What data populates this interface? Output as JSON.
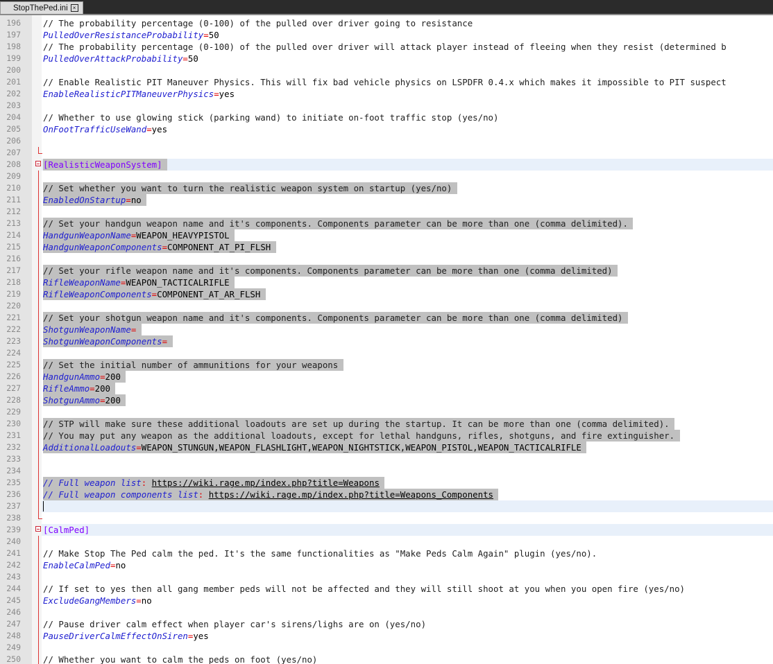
{
  "tab": {
    "title": "StopThePed.ini",
    "close_glyph": "×"
  },
  "editor": {
    "lines": [
      {
        "n": "196",
        "parts": [
          {
            "t": "// The probability percentage (0-100) of the pulled over driver going to resistance",
            "c": "comment"
          }
        ]
      },
      {
        "n": "197",
        "parts": [
          {
            "t": "PulledOverResistanceProbability",
            "c": "key"
          },
          {
            "t": "=",
            "c": "eq"
          },
          {
            "t": "50",
            "c": "val"
          }
        ]
      },
      {
        "n": "198",
        "parts": [
          {
            "t": "// The probability percentage (0-100) of the pulled over driver will attack player instead of fleeing when they resist (determined b",
            "c": "comment"
          }
        ]
      },
      {
        "n": "199",
        "parts": [
          {
            "t": "PulledOverAttackProbability",
            "c": "key"
          },
          {
            "t": "=",
            "c": "eq"
          },
          {
            "t": "50",
            "c": "val"
          }
        ]
      },
      {
        "n": "200",
        "parts": []
      },
      {
        "n": "201",
        "parts": [
          {
            "t": "// Enable Realistic PIT Maneuver Physics. This will fix bad vehicle physics on LSPDFR 0.4.x which makes it impossible to PIT suspect",
            "c": "comment"
          }
        ]
      },
      {
        "n": "202",
        "parts": [
          {
            "t": "EnableRealisticPITManeuverPhysics",
            "c": "key"
          },
          {
            "t": "=",
            "c": "eq"
          },
          {
            "t": "yes",
            "c": "val"
          }
        ]
      },
      {
        "n": "203",
        "parts": []
      },
      {
        "n": "204",
        "parts": [
          {
            "t": "// Whether to use glowing stick (parking wand) to initiate on-foot traffic stop (yes/no)",
            "c": "comment"
          }
        ]
      },
      {
        "n": "205",
        "parts": [
          {
            "t": "OnFootTrafficUseWand",
            "c": "key"
          },
          {
            "t": "=",
            "c": "eq"
          },
          {
            "t": "yes",
            "c": "val"
          }
        ]
      },
      {
        "n": "206",
        "parts": []
      },
      {
        "n": "207",
        "parts": [],
        "fold": "end"
      },
      {
        "n": "208",
        "parts": [
          {
            "t": "[RealisticWeaponSystem]",
            "c": "section"
          }
        ],
        "fold": "start",
        "sel": true,
        "hl": true
      },
      {
        "n": "209",
        "parts": [],
        "fold": "line"
      },
      {
        "n": "210",
        "parts": [
          {
            "t": "// Set whether you want to turn the realistic weapon system on startup (yes/no)",
            "c": "comment"
          }
        ],
        "fold": "line",
        "sel": true
      },
      {
        "n": "211",
        "parts": [
          {
            "t": "EnabledOnStartup",
            "c": "key"
          },
          {
            "t": "=",
            "c": "eq"
          },
          {
            "t": "no",
            "c": "val"
          }
        ],
        "fold": "line",
        "sel": true
      },
      {
        "n": "212",
        "parts": [],
        "fold": "line"
      },
      {
        "n": "213",
        "parts": [
          {
            "t": "// Set your handgun weapon name and it's components. Components parameter can be more than one (comma delimited).",
            "c": "comment"
          }
        ],
        "fold": "line",
        "sel": true
      },
      {
        "n": "214",
        "parts": [
          {
            "t": "HandgunWeaponName",
            "c": "key"
          },
          {
            "t": "=",
            "c": "eq"
          },
          {
            "t": "WEAPON_HEAVYPISTOL",
            "c": "val"
          }
        ],
        "fold": "line",
        "sel": true
      },
      {
        "n": "215",
        "parts": [
          {
            "t": "HandgunWeaponComponents",
            "c": "key"
          },
          {
            "t": "=",
            "c": "eq"
          },
          {
            "t": "COMPONENT_AT_PI_FLSH",
            "c": "val"
          }
        ],
        "fold": "line",
        "sel": true
      },
      {
        "n": "216",
        "parts": [],
        "fold": "line"
      },
      {
        "n": "217",
        "parts": [
          {
            "t": "// Set your rifle weapon name and it's components. Components parameter can be more than one (comma delimited)",
            "c": "comment"
          }
        ],
        "fold": "line",
        "sel": true
      },
      {
        "n": "218",
        "parts": [
          {
            "t": "RifleWeaponName",
            "c": "key"
          },
          {
            "t": "=",
            "c": "eq"
          },
          {
            "t": "WEAPON_TACTICALRIFLE",
            "c": "val"
          }
        ],
        "fold": "line",
        "sel": true
      },
      {
        "n": "219",
        "parts": [
          {
            "t": "RifleWeaponComponents",
            "c": "key"
          },
          {
            "t": "=",
            "c": "eq"
          },
          {
            "t": "COMPONENT_AT_AR_FLSH",
            "c": "val"
          }
        ],
        "fold": "line",
        "sel": true
      },
      {
        "n": "220",
        "parts": [],
        "fold": "line"
      },
      {
        "n": "221",
        "parts": [
          {
            "t": "// Set your shotgun weapon name and it's components. Components parameter can be more than one (comma delimited)",
            "c": "comment"
          }
        ],
        "fold": "line",
        "sel": true
      },
      {
        "n": "222",
        "parts": [
          {
            "t": "ShotgunWeaponName",
            "c": "key"
          },
          {
            "t": "=",
            "c": "eq"
          }
        ],
        "fold": "line",
        "sel": true
      },
      {
        "n": "223",
        "parts": [
          {
            "t": "ShotgunWeaponComponents",
            "c": "key"
          },
          {
            "t": "=",
            "c": "eq"
          }
        ],
        "fold": "line",
        "sel": true
      },
      {
        "n": "224",
        "parts": [],
        "fold": "line"
      },
      {
        "n": "225",
        "parts": [
          {
            "t": "// Set the initial number of ammunitions for your weapons",
            "c": "comment"
          }
        ],
        "fold": "line",
        "sel": true
      },
      {
        "n": "226",
        "parts": [
          {
            "t": "HandgunAmmo",
            "c": "key"
          },
          {
            "t": "=",
            "c": "eq"
          },
          {
            "t": "200",
            "c": "val"
          }
        ],
        "fold": "line",
        "sel": true
      },
      {
        "n": "227",
        "parts": [
          {
            "t": "RifleAmmo",
            "c": "key"
          },
          {
            "t": "=",
            "c": "eq"
          },
          {
            "t": "200",
            "c": "val"
          }
        ],
        "fold": "line",
        "sel": true
      },
      {
        "n": "228",
        "parts": [
          {
            "t": "ShotgunAmmo",
            "c": "key"
          },
          {
            "t": "=",
            "c": "eq"
          },
          {
            "t": "200",
            "c": "val"
          }
        ],
        "fold": "line",
        "sel": true
      },
      {
        "n": "229",
        "parts": [],
        "fold": "line"
      },
      {
        "n": "230",
        "parts": [
          {
            "t": "// STP will make sure these additional loadouts are set up during the startup. It can be more than one (comma delimited).",
            "c": "comment"
          }
        ],
        "fold": "line",
        "sel": true
      },
      {
        "n": "231",
        "parts": [
          {
            "t": "// You may put any weapon as the additional loadouts, except for lethal handguns, rifles, shotguns, and fire extinguisher.",
            "c": "comment"
          }
        ],
        "fold": "line",
        "sel": true
      },
      {
        "n": "232",
        "parts": [
          {
            "t": "AdditionalLoadouts",
            "c": "key"
          },
          {
            "t": "=",
            "c": "eq"
          },
          {
            "t": "WEAPON_STUNGUN,WEAPON_FLASHLIGHT,WEAPON_NIGHTSTICK,WEAPON_PISTOL,WEAPON_TACTICALRIFLE",
            "c": "val"
          }
        ],
        "fold": "line",
        "sel": true
      },
      {
        "n": "233",
        "parts": [],
        "fold": "line"
      },
      {
        "n": "234",
        "parts": [],
        "fold": "line"
      },
      {
        "n": "235",
        "parts": [
          {
            "t": "// Full weapon list",
            "c": "key"
          },
          {
            "t": ": ",
            "c": "eq"
          },
          {
            "t": "https://wiki.rage.mp/index.php?title=Weapons",
            "c": "url"
          }
        ],
        "fold": "line",
        "sel": true
      },
      {
        "n": "236",
        "parts": [
          {
            "t": "// Full weapon components list",
            "c": "key"
          },
          {
            "t": ": ",
            "c": "eq"
          },
          {
            "t": "https://wiki.rage.mp/index.php?title=Weapons_Components",
            "c": "url"
          }
        ],
        "fold": "line",
        "sel": true
      },
      {
        "n": "237",
        "parts": [],
        "fold": "line",
        "cur": true
      },
      {
        "n": "238",
        "parts": [],
        "fold": "end"
      },
      {
        "n": "239",
        "parts": [
          {
            "t": "[CalmPed]",
            "c": "section"
          }
        ],
        "fold": "start",
        "hl": true
      },
      {
        "n": "240",
        "parts": [],
        "fold": "line"
      },
      {
        "n": "241",
        "parts": [
          {
            "t": "// Make Stop The Ped calm the ped. It's the same functionalities as \"Make Peds Calm Again\" plugin (yes/no).",
            "c": "comment"
          }
        ],
        "fold": "line"
      },
      {
        "n": "242",
        "parts": [
          {
            "t": "EnableCalmPed",
            "c": "key"
          },
          {
            "t": "=",
            "c": "eq"
          },
          {
            "t": "no",
            "c": "val"
          }
        ],
        "fold": "line"
      },
      {
        "n": "243",
        "parts": [],
        "fold": "line"
      },
      {
        "n": "244",
        "parts": [
          {
            "t": "// If set to yes then all gang member peds will not be affected and they will still shoot at you when you open fire (yes/no)",
            "c": "comment"
          }
        ],
        "fold": "line"
      },
      {
        "n": "245",
        "parts": [
          {
            "t": "ExcludeGangMembers",
            "c": "key"
          },
          {
            "t": "=",
            "c": "eq"
          },
          {
            "t": "no",
            "c": "val"
          }
        ],
        "fold": "line"
      },
      {
        "n": "246",
        "parts": [],
        "fold": "line"
      },
      {
        "n": "247",
        "parts": [
          {
            "t": "// Pause driver calm effect when player car's sirens/lighs are on (yes/no)",
            "c": "comment"
          }
        ],
        "fold": "line"
      },
      {
        "n": "248",
        "parts": [
          {
            "t": "PauseDriverCalmEffectOnSiren",
            "c": "key"
          },
          {
            "t": "=",
            "c": "eq"
          },
          {
            "t": "yes",
            "c": "val"
          }
        ],
        "fold": "line"
      },
      {
        "n": "249",
        "parts": [],
        "fold": "line"
      },
      {
        "n": "250",
        "parts": [
          {
            "t": "// Whether you want to calm the peds on foot (yes/no)",
            "c": "comment"
          }
        ],
        "fold": "line"
      }
    ]
  },
  "colors": {
    "comment": "#202020",
    "section": "#8000ff",
    "key": "#2020d0",
    "eq": "#e00000",
    "selection": "#c0c0c0",
    "current_line": "#e8f0fa"
  }
}
